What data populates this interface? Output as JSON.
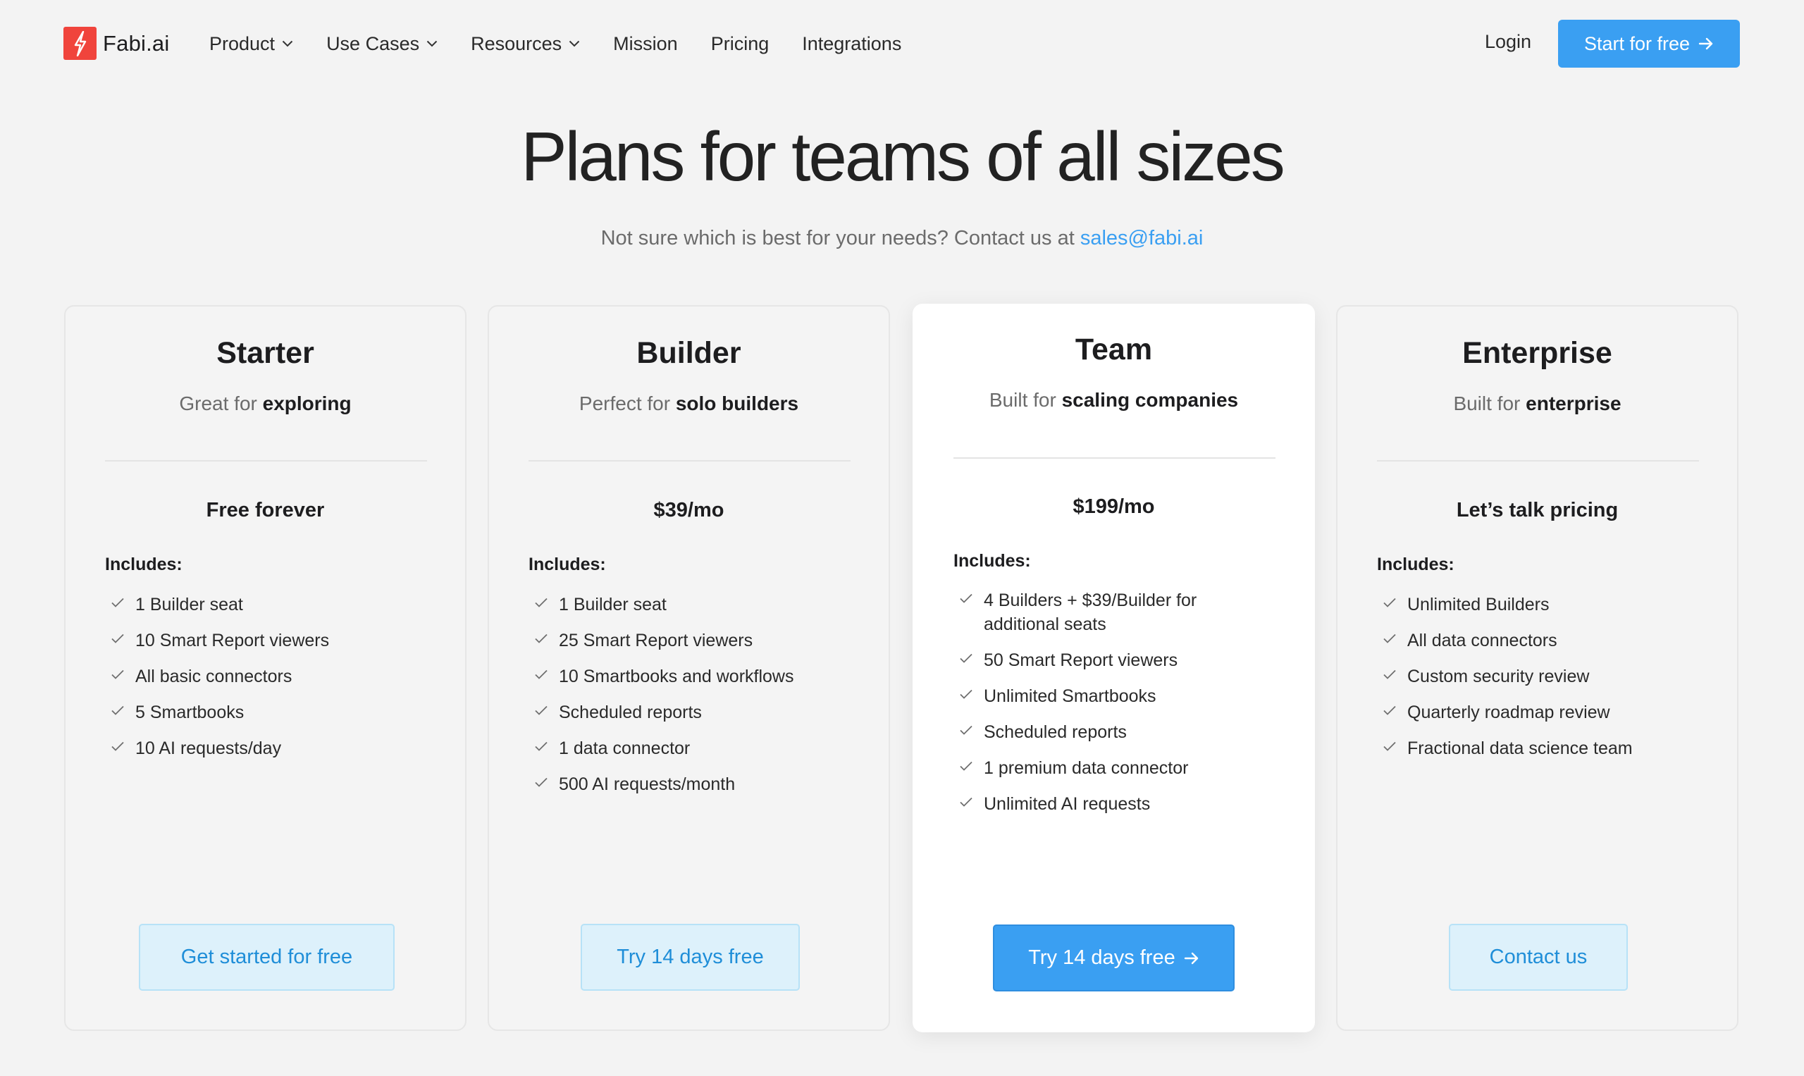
{
  "nav": {
    "brand": "Fabi.ai",
    "links": [
      {
        "label": "Product",
        "has_dropdown": true
      },
      {
        "label": "Use Cases",
        "has_dropdown": true
      },
      {
        "label": "Resources",
        "has_dropdown": true
      },
      {
        "label": "Mission",
        "has_dropdown": false
      },
      {
        "label": "Pricing",
        "has_dropdown": false
      },
      {
        "label": "Integrations",
        "has_dropdown": false
      }
    ],
    "login": "Login",
    "cta": "Start for free"
  },
  "hero": {
    "title": "Plans for teams of all sizes",
    "subtitle": "Not sure which is best for your needs? Contact us at ",
    "email": "sales@fabi.ai"
  },
  "plans": [
    {
      "name": "Starter",
      "tag_prefix": "Great for ",
      "tag_bold": "exploring",
      "price": "Free forever",
      "includes_label": "Includes:",
      "features": [
        "1 Builder seat",
        "10 Smart Report viewers",
        "All basic connectors",
        "5 Smartbooks",
        "10 AI requests/day"
      ],
      "button": "Get started for free"
    },
    {
      "name": "Builder",
      "tag_prefix": "Perfect for ",
      "tag_bold": "solo builders",
      "price": "$39/mo",
      "includes_label": "Includes:",
      "features": [
        "1 Builder seat",
        "25 Smart Report viewers",
        "10 Smartbooks and workflows",
        "Scheduled reports",
        "1 data connector",
        "500 AI requests/month"
      ],
      "button": "Try 14 days free"
    },
    {
      "name": "Team",
      "tag_prefix": "Built for ",
      "tag_bold": "scaling companies",
      "price": "$199/mo",
      "includes_label": "Includes:",
      "features": [
        "4 Builders + $39/Builder for additional seats",
        "50 Smart Report viewers",
        "Unlimited Smartbooks",
        "Scheduled reports",
        "1 premium data connector",
        "Unlimited AI requests"
      ],
      "button": "Try 14 days free"
    },
    {
      "name": "Enterprise",
      "tag_prefix": "Built for ",
      "tag_bold": "enterprise",
      "price": "Let’s talk pricing",
      "includes_label": "Includes:",
      "features": [
        "Unlimited Builders",
        "All data connectors",
        "Custom security review",
        "Quarterly roadmap review",
        "Fractional data science team"
      ],
      "button": "Contact us"
    }
  ],
  "colors": {
    "accent": "#3a9ff2",
    "brand_red": "#f0443c",
    "background": "#f3f3f3",
    "secondary_button_bg": "#ddf1fb",
    "secondary_button_text": "#1f8ed8"
  },
  "icons": {
    "brand": "lightning-bolt-icon",
    "dropdown": "chevron-down-icon",
    "arrow": "arrow-right-icon",
    "feature": "check-icon"
  }
}
